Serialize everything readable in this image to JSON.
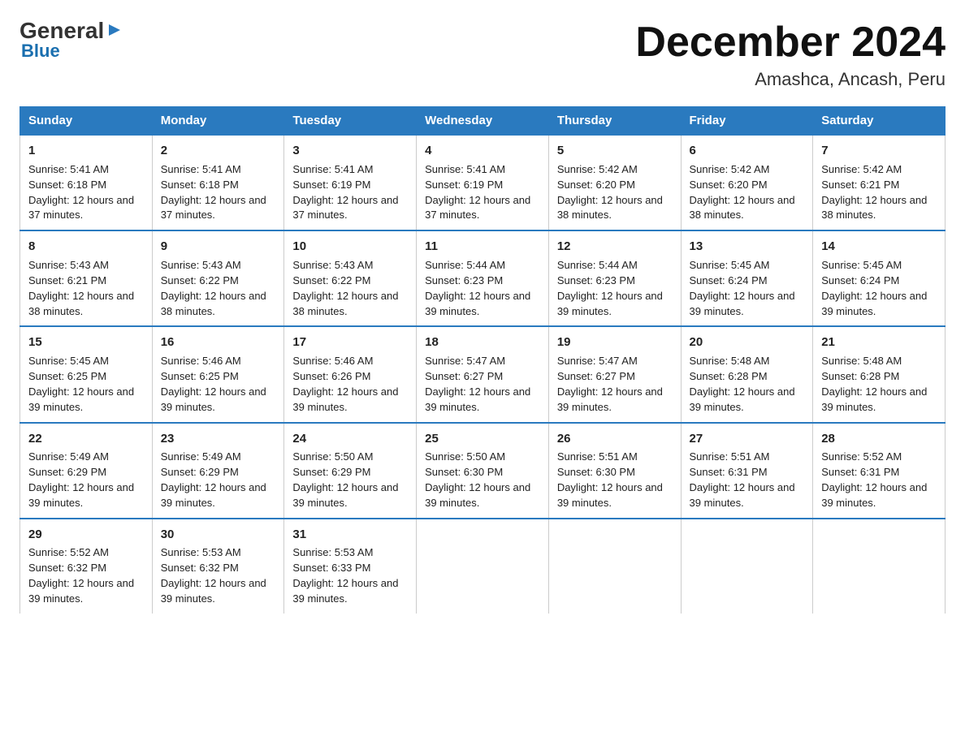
{
  "logo": {
    "general": "General",
    "arrow": "▶",
    "blue": "Blue"
  },
  "header": {
    "month": "December 2024",
    "location": "Amashca, Ancash, Peru"
  },
  "weekdays": [
    "Sunday",
    "Monday",
    "Tuesday",
    "Wednesday",
    "Thursday",
    "Friday",
    "Saturday"
  ],
  "weeks": [
    [
      {
        "day": "1",
        "sunrise": "5:41 AM",
        "sunset": "6:18 PM",
        "daylight": "12 hours and 37 minutes."
      },
      {
        "day": "2",
        "sunrise": "5:41 AM",
        "sunset": "6:18 PM",
        "daylight": "12 hours and 37 minutes."
      },
      {
        "day": "3",
        "sunrise": "5:41 AM",
        "sunset": "6:19 PM",
        "daylight": "12 hours and 37 minutes."
      },
      {
        "day": "4",
        "sunrise": "5:41 AM",
        "sunset": "6:19 PM",
        "daylight": "12 hours and 37 minutes."
      },
      {
        "day": "5",
        "sunrise": "5:42 AM",
        "sunset": "6:20 PM",
        "daylight": "12 hours and 38 minutes."
      },
      {
        "day": "6",
        "sunrise": "5:42 AM",
        "sunset": "6:20 PM",
        "daylight": "12 hours and 38 minutes."
      },
      {
        "day": "7",
        "sunrise": "5:42 AM",
        "sunset": "6:21 PM",
        "daylight": "12 hours and 38 minutes."
      }
    ],
    [
      {
        "day": "8",
        "sunrise": "5:43 AM",
        "sunset": "6:21 PM",
        "daylight": "12 hours and 38 minutes."
      },
      {
        "day": "9",
        "sunrise": "5:43 AM",
        "sunset": "6:22 PM",
        "daylight": "12 hours and 38 minutes."
      },
      {
        "day": "10",
        "sunrise": "5:43 AM",
        "sunset": "6:22 PM",
        "daylight": "12 hours and 38 minutes."
      },
      {
        "day": "11",
        "sunrise": "5:44 AM",
        "sunset": "6:23 PM",
        "daylight": "12 hours and 39 minutes."
      },
      {
        "day": "12",
        "sunrise": "5:44 AM",
        "sunset": "6:23 PM",
        "daylight": "12 hours and 39 minutes."
      },
      {
        "day": "13",
        "sunrise": "5:45 AM",
        "sunset": "6:24 PM",
        "daylight": "12 hours and 39 minutes."
      },
      {
        "day": "14",
        "sunrise": "5:45 AM",
        "sunset": "6:24 PM",
        "daylight": "12 hours and 39 minutes."
      }
    ],
    [
      {
        "day": "15",
        "sunrise": "5:45 AM",
        "sunset": "6:25 PM",
        "daylight": "12 hours and 39 minutes."
      },
      {
        "day": "16",
        "sunrise": "5:46 AM",
        "sunset": "6:25 PM",
        "daylight": "12 hours and 39 minutes."
      },
      {
        "day": "17",
        "sunrise": "5:46 AM",
        "sunset": "6:26 PM",
        "daylight": "12 hours and 39 minutes."
      },
      {
        "day": "18",
        "sunrise": "5:47 AM",
        "sunset": "6:27 PM",
        "daylight": "12 hours and 39 minutes."
      },
      {
        "day": "19",
        "sunrise": "5:47 AM",
        "sunset": "6:27 PM",
        "daylight": "12 hours and 39 minutes."
      },
      {
        "day": "20",
        "sunrise": "5:48 AM",
        "sunset": "6:28 PM",
        "daylight": "12 hours and 39 minutes."
      },
      {
        "day": "21",
        "sunrise": "5:48 AM",
        "sunset": "6:28 PM",
        "daylight": "12 hours and 39 minutes."
      }
    ],
    [
      {
        "day": "22",
        "sunrise": "5:49 AM",
        "sunset": "6:29 PM",
        "daylight": "12 hours and 39 minutes."
      },
      {
        "day": "23",
        "sunrise": "5:49 AM",
        "sunset": "6:29 PM",
        "daylight": "12 hours and 39 minutes."
      },
      {
        "day": "24",
        "sunrise": "5:50 AM",
        "sunset": "6:29 PM",
        "daylight": "12 hours and 39 minutes."
      },
      {
        "day": "25",
        "sunrise": "5:50 AM",
        "sunset": "6:30 PM",
        "daylight": "12 hours and 39 minutes."
      },
      {
        "day": "26",
        "sunrise": "5:51 AM",
        "sunset": "6:30 PM",
        "daylight": "12 hours and 39 minutes."
      },
      {
        "day": "27",
        "sunrise": "5:51 AM",
        "sunset": "6:31 PM",
        "daylight": "12 hours and 39 minutes."
      },
      {
        "day": "28",
        "sunrise": "5:52 AM",
        "sunset": "6:31 PM",
        "daylight": "12 hours and 39 minutes."
      }
    ],
    [
      {
        "day": "29",
        "sunrise": "5:52 AM",
        "sunset": "6:32 PM",
        "daylight": "12 hours and 39 minutes."
      },
      {
        "day": "30",
        "sunrise": "5:53 AM",
        "sunset": "6:32 PM",
        "daylight": "12 hours and 39 minutes."
      },
      {
        "day": "31",
        "sunrise": "5:53 AM",
        "sunset": "6:33 PM",
        "daylight": "12 hours and 39 minutes."
      },
      null,
      null,
      null,
      null
    ]
  ],
  "labels": {
    "sunrise": "Sunrise:",
    "sunset": "Sunset:",
    "daylight": "Daylight:"
  }
}
